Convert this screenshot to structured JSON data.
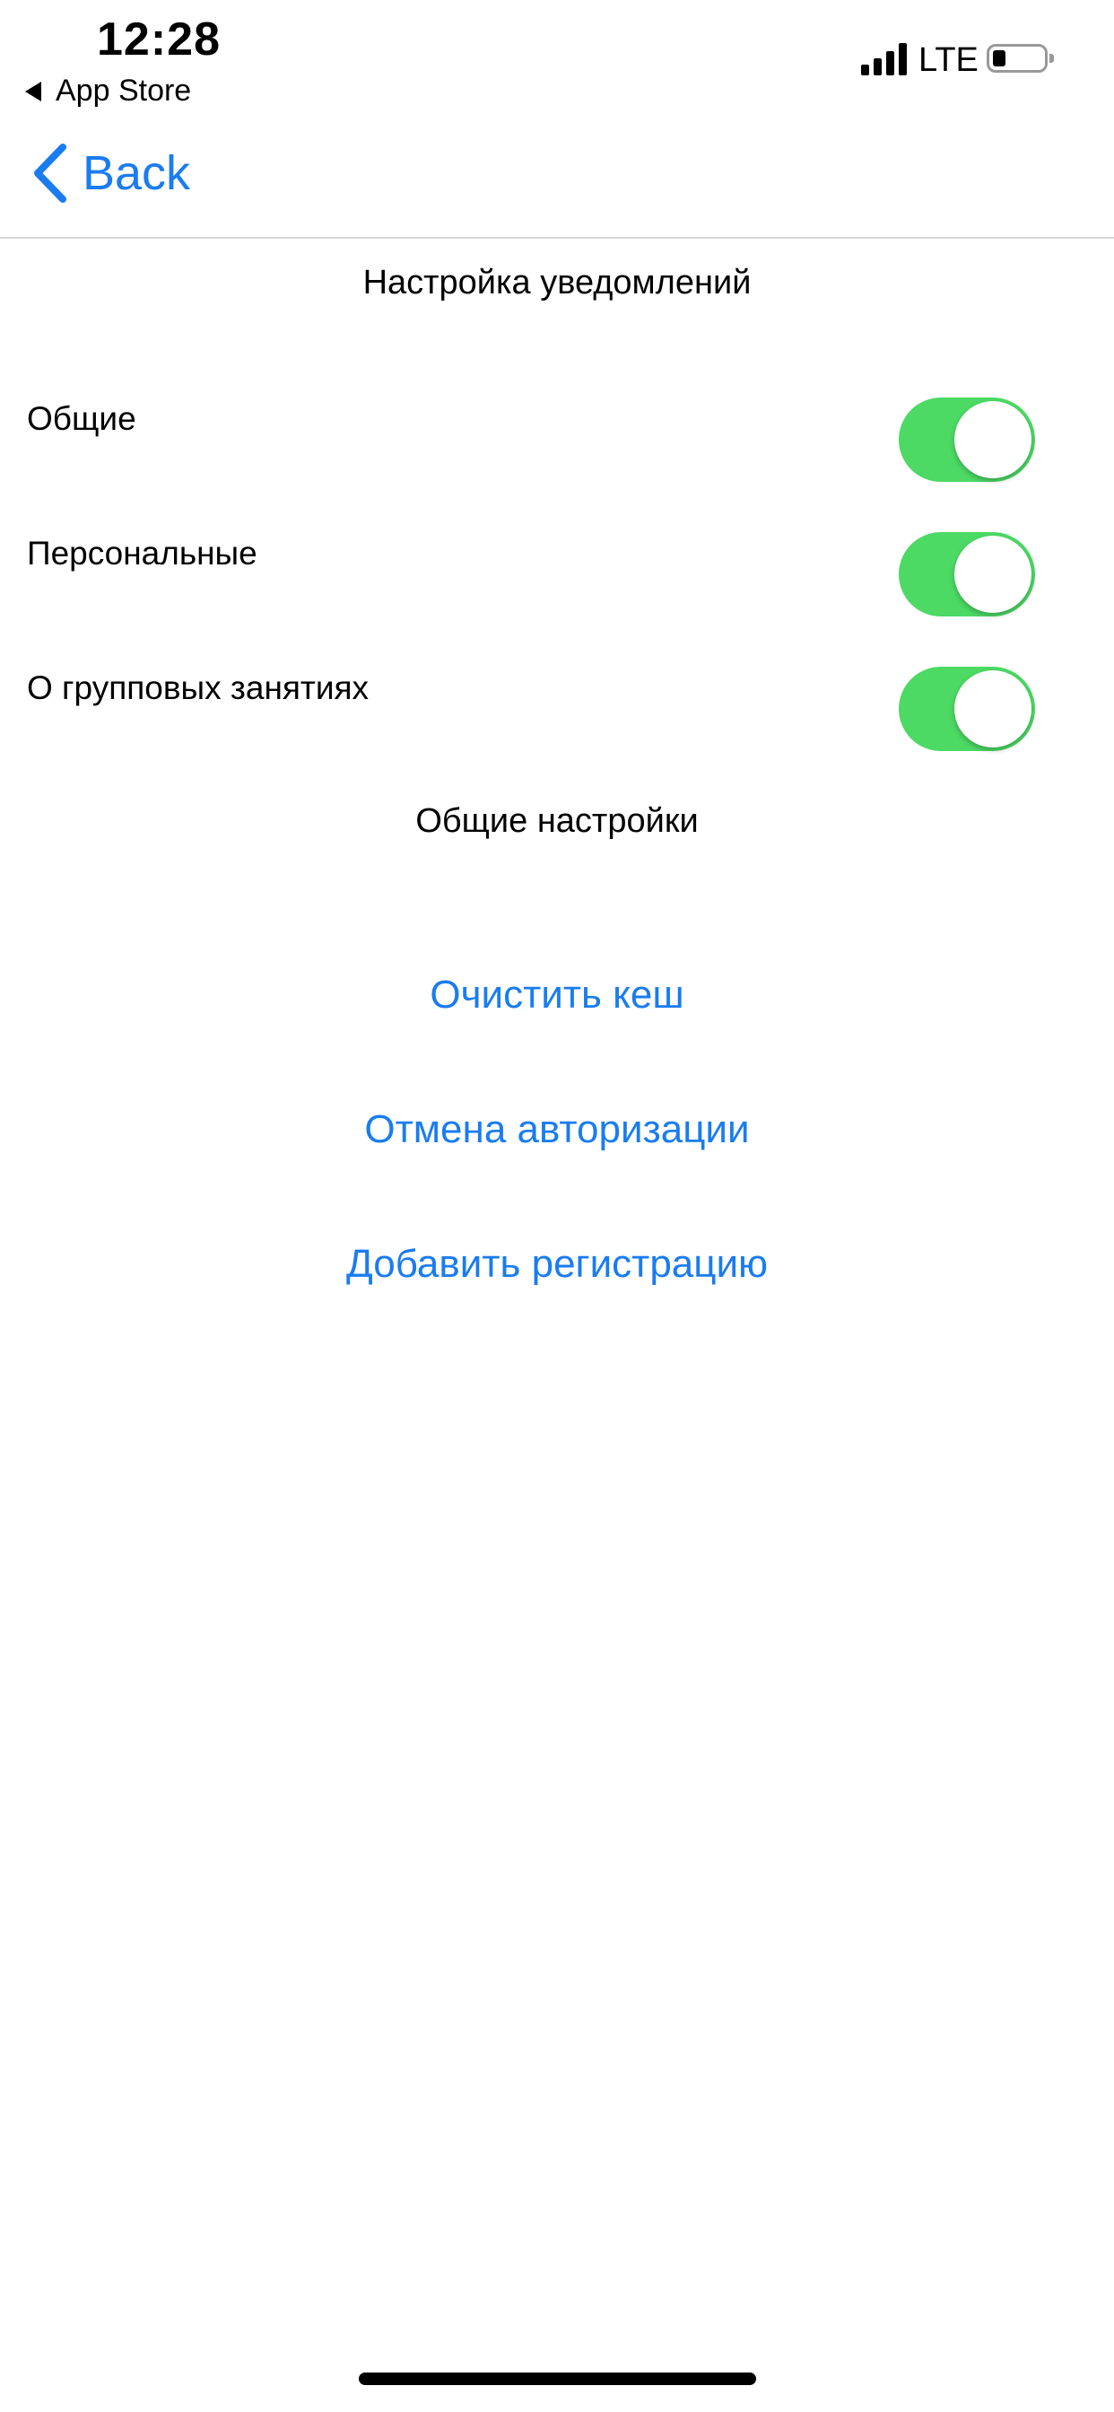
{
  "status_bar": {
    "time": "12:28",
    "back_app": "App Store",
    "network": "LTE"
  },
  "nav": {
    "back_label": "Back"
  },
  "notifications": {
    "title": "Настройка уведомлений",
    "rows": [
      {
        "label": "Общие",
        "enabled": true
      },
      {
        "label": "Персональные",
        "enabled": true
      },
      {
        "label": "О групповых занятиях",
        "enabled": true
      }
    ]
  },
  "general": {
    "title": "Общие настройки",
    "clear_cache": "Очистить кеш",
    "logout": "Отмена авторизации",
    "add_registration": "Добавить регистрацию"
  },
  "colors": {
    "accent": "#1a7cf0",
    "toggle_on": "#4cd964"
  }
}
